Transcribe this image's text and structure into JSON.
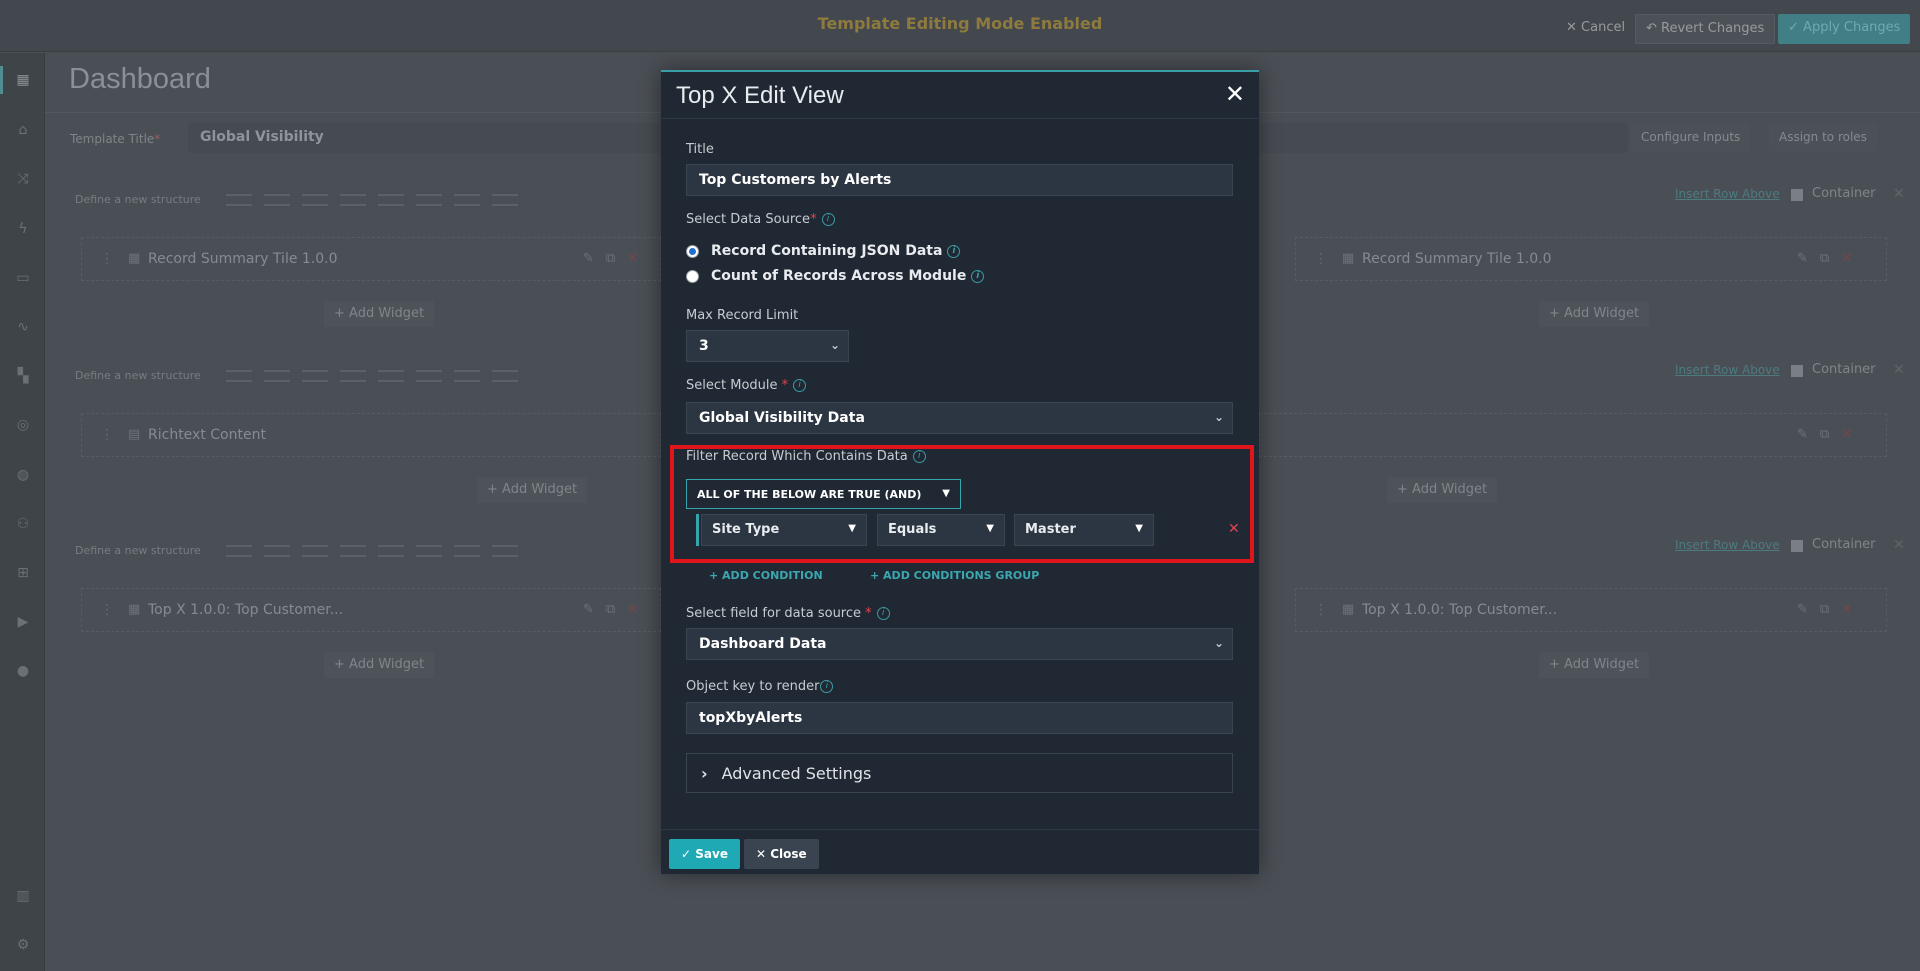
{
  "topbar": {
    "mode_text": "Template Editing Mode Enabled",
    "cancel_label": "Cancel",
    "revert_label": "Revert Changes",
    "apply_label": "Apply Changes"
  },
  "dashboard": {
    "title": "Dashboard",
    "template_title_label": "Template Title",
    "template_title_value": "Global Visibility",
    "configure_inputs_label": "Configure Inputs",
    "assign_roles_label": "Assign to roles",
    "structure_label": "Define a new structure",
    "insert_row_label": "Insert Row Above",
    "container_label": "Container",
    "add_widget_label": "Add Widget",
    "widgets": {
      "r1_left": "Record Summary Tile 1.0.0",
      "r1_right": "Record Summary Tile 1.0.0",
      "r2_left": "Richtext Content",
      "r3_left": "Top X 1.0.0: Top Customer...",
      "r3_right": "Top X 1.0.0: Top Customer..."
    }
  },
  "modal": {
    "title": "Top X Edit View",
    "title_label": "Title",
    "title_value": "Top Customers by Alerts",
    "data_source_label": "Select Data Source",
    "radio_json": "Record Containing JSON Data",
    "radio_count": "Count of Records Across Module",
    "max_limit_label": "Max Record Limit",
    "max_limit_value": "3",
    "module_label": "Select Module",
    "module_value": "Global Visibility Data",
    "filter_label": "Filter Record Which Contains Data",
    "logic_value": "ALL OF THE BELOW ARE TRUE (AND)",
    "condition": {
      "field": "Site Type",
      "operator": "Equals",
      "value": "Master"
    },
    "add_condition": "+ ADD CONDITION",
    "add_group": "+ ADD CONDITIONS GROUP",
    "field_source_label": "Select field for data source",
    "field_source_value": "Dashboard Data",
    "object_key_label": "Object key to render",
    "object_key_value": "topXbyAlerts",
    "advanced_label": "Advanced Settings",
    "save_label": "Save",
    "close_label": "Close"
  },
  "colors": {
    "accent": "#1fa9b4",
    "highlight_box": "#e0141b",
    "modal_bg": "#1f2833"
  }
}
